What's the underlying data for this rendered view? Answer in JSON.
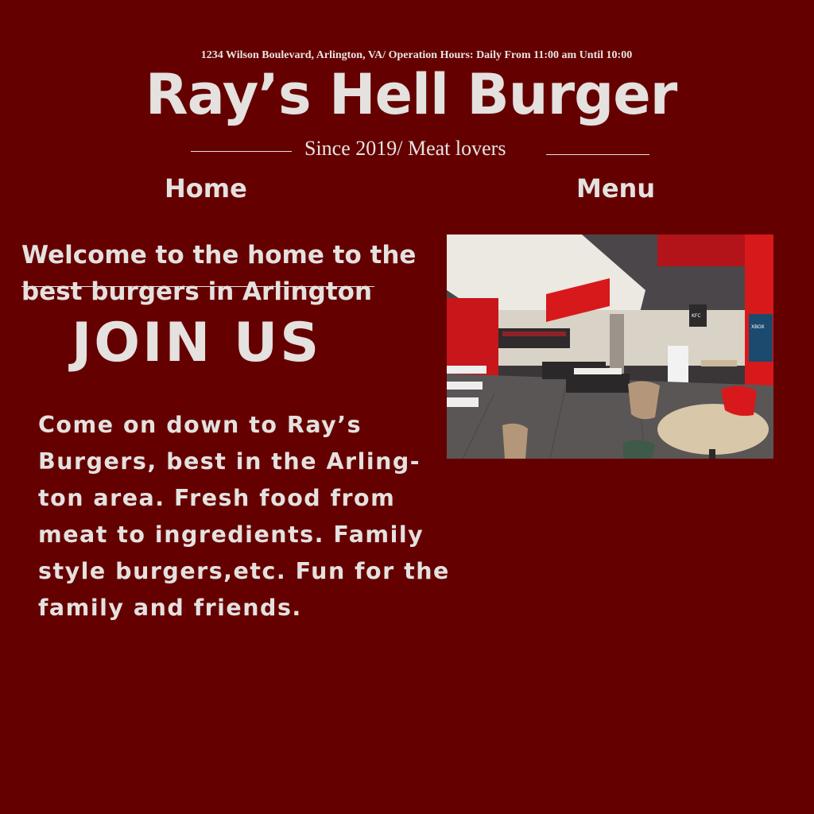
{
  "header": {
    "address": "1234 Wilson Boulevard, Arlington, VA/ Operation Hours: Daily From 11:00 am Until 10:00",
    "title": "Ray’s Hell Burger",
    "tagline": "Since 2019/ Meat lovers"
  },
  "nav": {
    "home": "Home",
    "menu": "Menu"
  },
  "main": {
    "welcome": "Welcome to the home to the best burgers in Arlington",
    "join": "JOIN US",
    "body": "Come on down to Ray’s Burgers, best in the Arling-ton area. Fresh food from meat to ingredients. Family style burgers,etc. Fun for the family and friends.",
    "body_lines": [
      "Come on down to Ray’s",
      "Burgers, best in the Arling-",
      "ton area. Fresh food from",
      "meat to ingredients. Family",
      "style burgers,etc. Fun for the",
      "family and friends."
    ],
    "photo_sign": "KFC",
    "photo_screen": "XBOX"
  },
  "colors": {
    "background": "#650000",
    "text": "#e4e1df",
    "accent_red": "#d8191b"
  }
}
